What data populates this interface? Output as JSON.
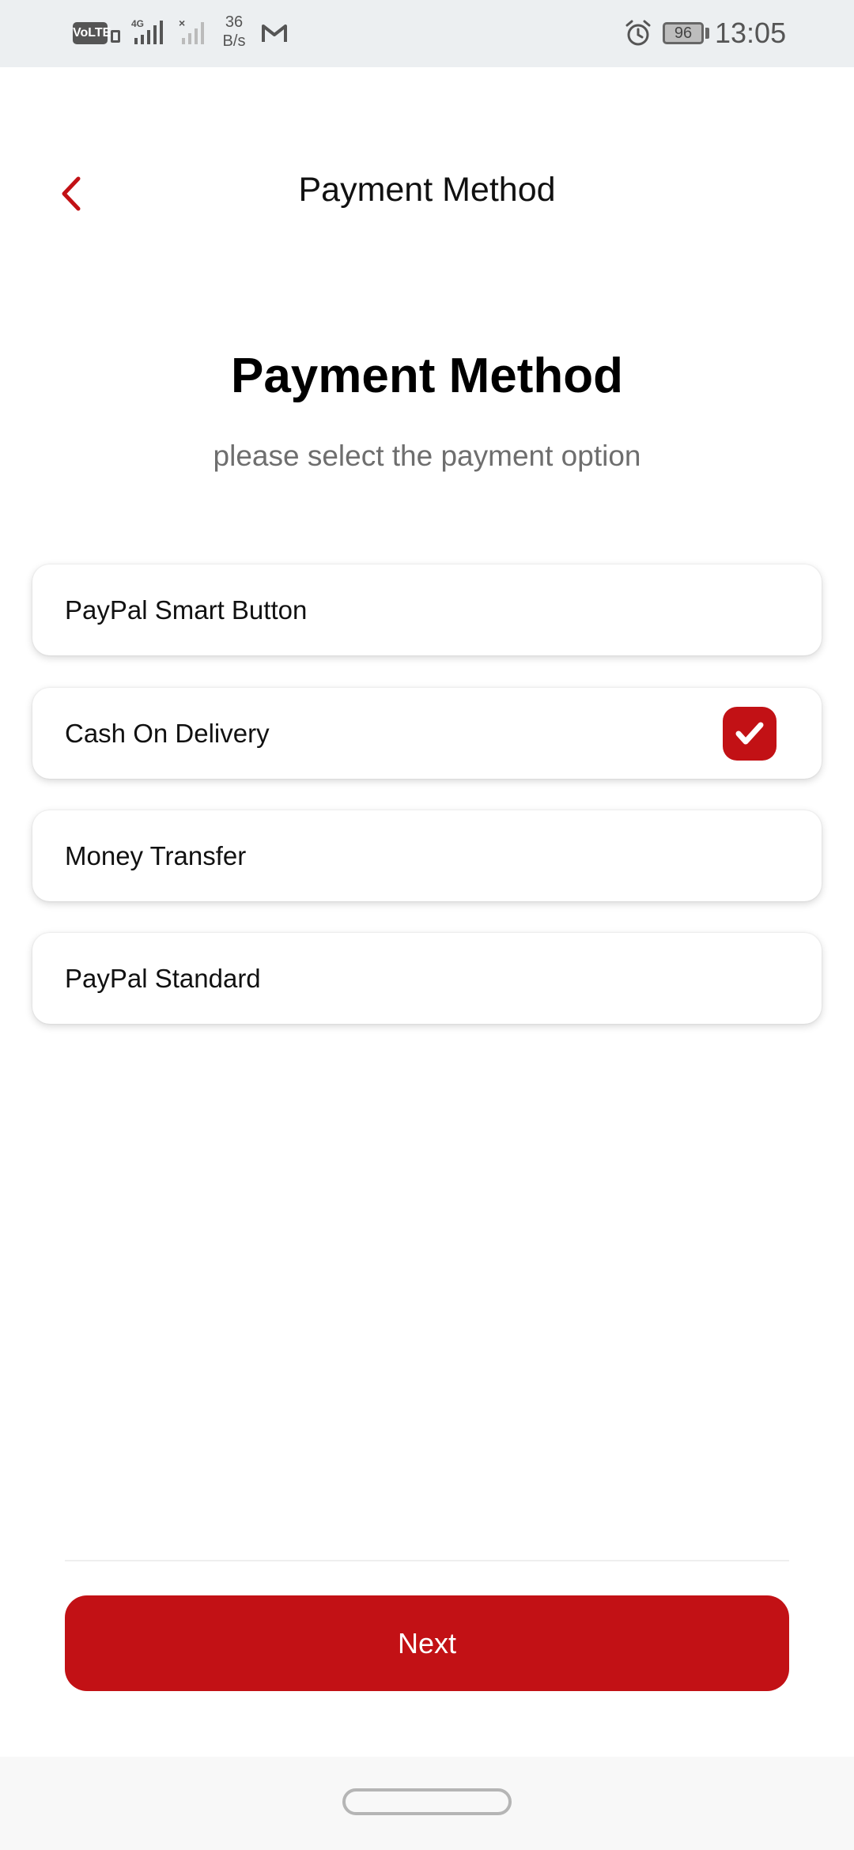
{
  "status_bar": {
    "volte": "VoLTE",
    "network_speed_value": "36",
    "network_speed_unit": "B/s",
    "battery": "96",
    "time": "13:05"
  },
  "header": {
    "title": "Payment Method",
    "back_icon": "chevron-left-icon"
  },
  "content": {
    "title": "Payment Method",
    "subtitle": "please select the payment option"
  },
  "options": [
    {
      "label": "PayPal Smart Button",
      "selected": false
    },
    {
      "label": "Cash On Delivery",
      "selected": true
    },
    {
      "label": "Money Transfer",
      "selected": false
    },
    {
      "label": "PayPal Standard",
      "selected": false
    }
  ],
  "next_button": {
    "label": "Next"
  },
  "colors": {
    "accent": "#c21115",
    "status_bar": "#eceff1",
    "subtitle": "#6e6e6e"
  }
}
